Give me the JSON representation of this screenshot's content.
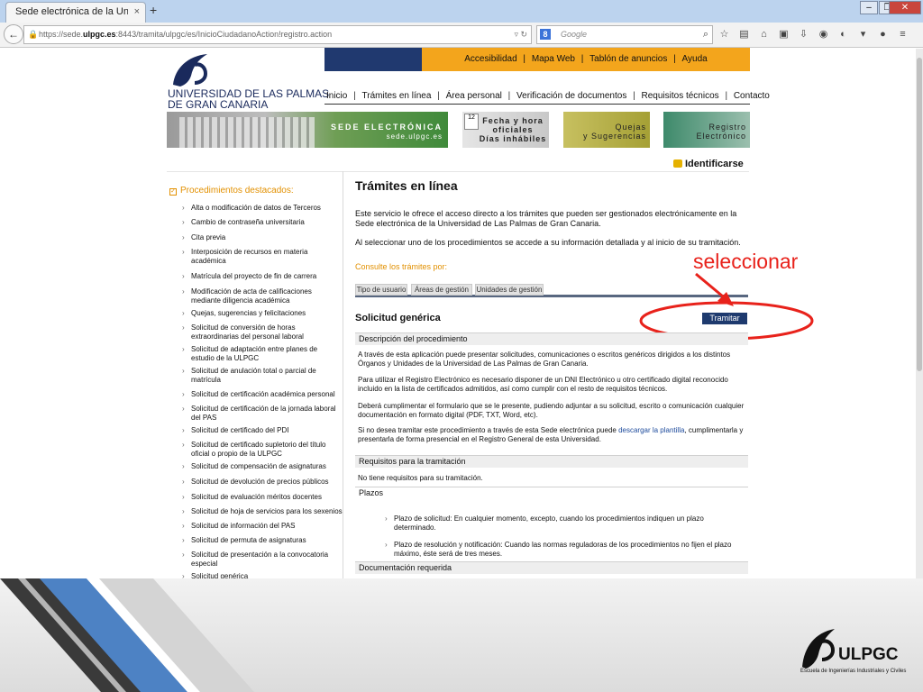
{
  "browser": {
    "tab_title": "Sede electrónica de la Universi...",
    "tab_close": "×",
    "new_tab": "+",
    "url_prefix": "https://sede.",
    "url_domain": "ulpgc.es",
    "url_suffix": ":8443/tramita/ulpgc/es/InicioCiudadanoAction!registro.action",
    "search_placeholder": "Google",
    "search_engine_label": "8"
  },
  "header": {
    "logo_line1": "UNIVERSIDAD DE LAS PALMAS",
    "logo_line2": "DE GRAN CANARIA",
    "top_links": [
      "Accesibilidad",
      "Mapa Web",
      "Tablón de anuncios",
      "Ayuda"
    ],
    "nav": [
      "Inicio",
      "Trámites en línea",
      "Área personal",
      "Verificación de documentos",
      "Requisitos técnicos",
      "Contacto"
    ],
    "separator": "|"
  },
  "banners": {
    "sede_line1": "SEDE ELECTRÓNICA",
    "sede_line2": "sede.ulpgc.es",
    "fecha_line1": "Fecha y hora",
    "fecha_line2": "oficiales",
    "fecha_line3": "Días inhábiles",
    "fecha_cal": "12",
    "quejas_line1": "Quejas",
    "quejas_line2": "y Sugerencias",
    "registro_line1": "Registro",
    "registro_line2": "Electrónico"
  },
  "identificarse": "Identificarse",
  "sidebar": {
    "heading": "Procedimientos destacados:",
    "items": [
      "Alta o modificación de datos de Terceros",
      "Cambio de contraseña universitaria",
      "Cita previa",
      "Interposición de recursos en materia académica",
      "Matrícula del proyecto de fin de carrera",
      "Modificación de acta de calificaciones mediante diligencia académica",
      "Quejas, sugerencias y felicitaciones",
      "Solicitud de conversión de horas extraordinarias del personal laboral",
      "Solicitud de adaptación entre planes de estudio de la ULPGC",
      "Solicitud de anulación total o parcial de matrícula",
      "Solicitud de certificación académica personal",
      "Solicitud de certificación de la jornada laboral del PAS",
      "Solicitud de certificado del PDI",
      "Solicitud de certificado supletorio del título oficial o propio de la ULPGC",
      "Solicitud de compensación de asignaturas",
      "Solicitud de devolución de precios públicos",
      "Solicitud de evaluación méritos docentes",
      "Solicitud de hoja de servicios para los sexenios",
      "Solicitud de información del PAS",
      "Solicitud de permuta de asignaturas",
      "Solicitud de presentación a la convocatoria especial",
      "Solicitud genérica"
    ]
  },
  "main": {
    "title": "Trámites en línea",
    "intro1": "Este servicio le ofrece el acceso directo a los trámites que pueden ser gestionados electrónicamente en la Sede electrónica de la Universidad de Las Palmas de Gran Canaria.",
    "intro2": "Al seleccionar uno de los procedimientos se accede a su información detallada y al inicio de su tramitación.",
    "consulte": "Consulte los trámites por:",
    "tabs": [
      "Tipo de usuario",
      "Áreas de gestión",
      "Unidades de gestión"
    ],
    "annotation": "seleccionar",
    "proc_title": "Solicitud genérica",
    "tramitar": "Tramitar",
    "desc_header": "Descripción del procedimiento",
    "desc_p1": "A través de esta aplicación puede presentar solicitudes, comunicaciones o escritos genéricos dirigidos a los distintos Órganos y Unidades de la Universidad de Las Palmas de Gran Canaria.",
    "desc_p2": "Para utilizar el Registro Electrónico es necesario disponer de un DNI Electrónico u otro certificado digital reconocido incluido en la lista de certificados admitidos, así como cumplir con el resto de requisitos técnicos.",
    "desc_p3": "Deberá cumplimentar el formulario que se le presente, pudiendo adjuntar a su solicitud, escrito o comunicación cualquier documentación en formato digital (PDF, TXT, Word, etc).",
    "desc_p4_a": "Si no desea tramitar este procedimiento a través de esta Sede electrónica puede ",
    "desc_p4_link": "descargar la plantilla",
    "desc_p4_b": ", cumplimentarla y presentarla de forma presencial en el Registro General de esta Universidad.",
    "req_header": "Requisitos para la tramitación",
    "req_text": "No tiene requisitos para su tramitación.",
    "plazos_header": "Plazos",
    "plazos": [
      "Plazo de solicitud: En cualquier momento, excepto, cuando los procedimientos indiquen un plazo determinado.",
      "Plazo de resolución y notificación: Cuando las normas reguladoras de los procedimientos no fijen el plazo máximo, éste será de tres meses."
    ],
    "doc_header": "Documentación requerida"
  },
  "footer": {
    "brand": "ULPGC",
    "subtitle": "Escuela de Ingenierías Industriales y Civiles"
  },
  "colors": {
    "accent_orange": "#f3a51c",
    "navy": "#20396f",
    "annotation_red": "#e8221b"
  }
}
